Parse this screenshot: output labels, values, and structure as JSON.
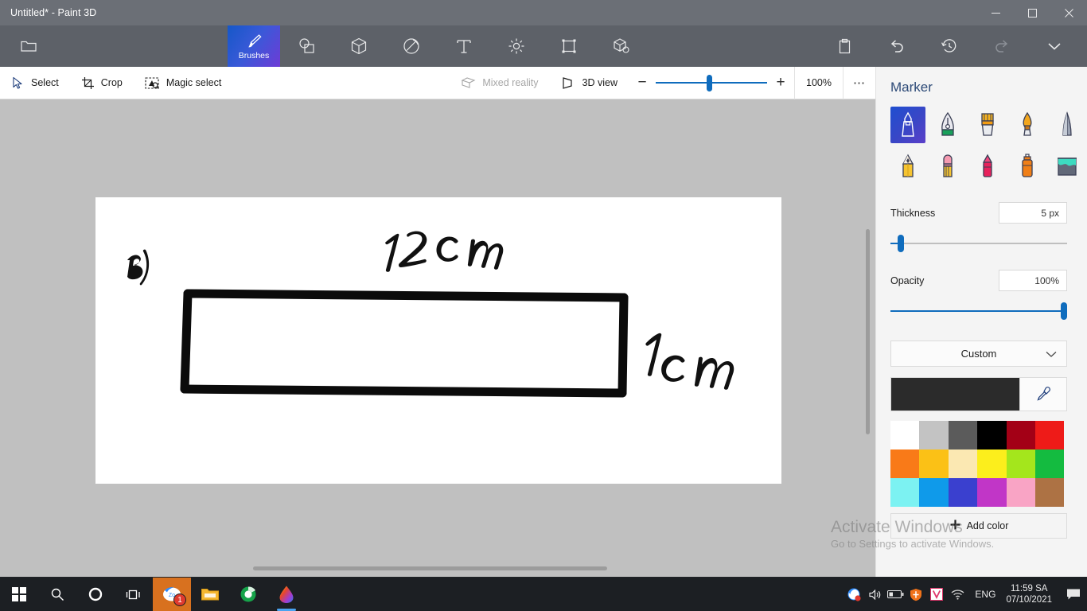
{
  "window": {
    "title": "Untitled* - Paint 3D",
    "controls": [
      {
        "name": "minimize-button",
        "glyph": "─"
      },
      {
        "name": "maximize-button",
        "glyph": "❐"
      },
      {
        "name": "close-button",
        "glyph": "✕"
      }
    ]
  },
  "ribbon": {
    "menu_icon": "folder-icon",
    "items": [
      {
        "label": "Brushes",
        "icon": "brush-icon",
        "active": true
      },
      {
        "label": "",
        "icon": "shapes-2d-icon",
        "active": false
      },
      {
        "label": "",
        "icon": "shapes-3d-icon",
        "active": false
      },
      {
        "label": "",
        "icon": "stickers-icon",
        "active": false
      },
      {
        "label": "",
        "icon": "text-icon",
        "active": false
      },
      {
        "label": "",
        "icon": "effects-icon",
        "active": false
      },
      {
        "label": "",
        "icon": "canvas-icon",
        "active": false
      },
      {
        "label": "",
        "icon": "3d-library-icon",
        "active": false
      }
    ],
    "right_icons": [
      {
        "name": "clipboard-icon",
        "disabled": false
      },
      {
        "name": "undo-icon",
        "disabled": false
      },
      {
        "name": "history-icon",
        "disabled": false
      },
      {
        "name": "redo-icon",
        "disabled": true
      },
      {
        "name": "chevron-down-icon",
        "disabled": false
      }
    ]
  },
  "toolbar": {
    "select_label": "Select",
    "crop_label": "Crop",
    "magic_select_label": "Magic select",
    "mixed_reality_label": "Mixed reality",
    "mixed_reality_disabled": true,
    "view_3d_label": "3D view",
    "zoom_minus": "−",
    "zoom_plus": "+",
    "zoom_percent": "100%",
    "more_label": "⋯"
  },
  "panel": {
    "title": "Marker",
    "brushes": [
      {
        "name": "marker-brush",
        "active": true
      },
      {
        "name": "calligraphy-pen-brush",
        "active": false
      },
      {
        "name": "oil-brush",
        "active": false
      },
      {
        "name": "watercolor-brush",
        "active": false
      },
      {
        "name": "pixel-pen-brush",
        "active": false
      },
      {
        "name": "pencil-brush",
        "active": false
      },
      {
        "name": "eraser-brush",
        "active": false
      },
      {
        "name": "crayon-brush",
        "active": false
      },
      {
        "name": "spray-can-brush",
        "active": false
      },
      {
        "name": "fill-brush",
        "active": false
      }
    ],
    "thickness_label": "Thickness",
    "thickness_value": "5 px",
    "thickness_percent": 4,
    "opacity_label": "Opacity",
    "opacity_value": "100%",
    "opacity_percent": 100,
    "color_mode_label": "Custom",
    "current_color": "#2b2b2b",
    "eyedropper_name": "eyedropper-icon",
    "swatches": [
      "#ffffff",
      "#c3c3c3",
      "#5b5b5b",
      "#000000",
      "#a30016",
      "#ee1b18",
      "#f97a18",
      "#fbc116",
      "#fbe8b2",
      "#fcee1c",
      "#a4e61c",
      "#14bb40",
      "#7cf2f2",
      "#0f9aea",
      "#3a40cf",
      "#c136c7",
      "#f9a4c5",
      "#ad7244"
    ],
    "add_color_label": "Add color"
  },
  "canvas": {
    "annotation_label": "B)",
    "top_dimension": "12cm",
    "right_dimension": "1cm",
    "shape": "rectangle"
  },
  "watermark": {
    "line1": "Activate Windows",
    "line2": "Go to Settings to activate Windows."
  },
  "taskbar": {
    "items": [
      {
        "name": "start-button",
        "icon": "windows-logo-icon"
      },
      {
        "name": "search-button",
        "icon": "search-icon"
      },
      {
        "name": "cortana-button",
        "icon": "cortana-circle-icon"
      },
      {
        "name": "task-view-button",
        "icon": "task-view-icon"
      },
      {
        "name": "zoom-app-button",
        "icon": "zoom-app-icon",
        "badge": "1",
        "highlight": true
      },
      {
        "name": "file-explorer-button",
        "icon": "folder-icon"
      },
      {
        "name": "browser-app-button",
        "icon": "browser-icon"
      },
      {
        "name": "paint3d-app-button",
        "icon": "paint3d-icon",
        "running": true
      }
    ],
    "tray": [
      {
        "name": "zoom-tray-icon"
      },
      {
        "name": "volume-icon"
      },
      {
        "name": "battery-icon"
      },
      {
        "name": "security-shield-icon"
      },
      {
        "name": "v-app-icon"
      },
      {
        "name": "wifi-icon"
      }
    ],
    "language": "ENG",
    "time": "11:59 SA",
    "date": "07/10/2021",
    "action_center_name": "action-center-icon"
  }
}
